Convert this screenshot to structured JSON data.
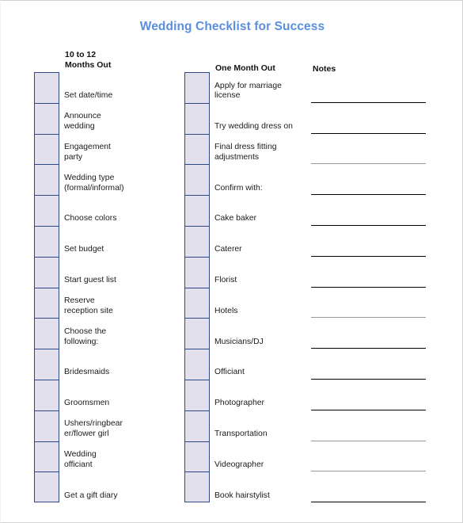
{
  "document": {
    "title": "Wedding Checklist for Success",
    "title_color": "#5a8ede"
  },
  "headers": {
    "left_column": "10 to 12\nMonths Out",
    "right_column": "One Month Out",
    "notes_column": "Notes"
  },
  "colors": {
    "checkbox_fill": "#e3e0ee",
    "checkbox_border": "#2e4a86",
    "rule_black": "#000000",
    "rule_gray": "#9a9a9a",
    "page_border": "#d2d2d2"
  },
  "columns": {
    "left": {
      "heading": "10 to 12 Months Out",
      "items": [
        {
          "label": "Set date/time",
          "checked": false
        },
        {
          "label": "Announce\nwedding",
          "checked": false
        },
        {
          "label": "Engagement\nparty",
          "checked": false
        },
        {
          "label": "Wedding type\n(formal/informal)",
          "checked": false
        },
        {
          "label": "Choose colors",
          "checked": false
        },
        {
          "label": "Set budget",
          "checked": false
        },
        {
          "label": "Start guest list",
          "checked": false
        },
        {
          "label": "Reserve\nreception site",
          "checked": false
        },
        {
          "label": "Choose the\nfollowing:",
          "checked": false
        },
        {
          "label": "Bridesmaids",
          "checked": false
        },
        {
          "label": "Groomsmen",
          "checked": false
        },
        {
          "label": "Ushers/ringbear\ner/flower girl",
          "checked": false
        },
        {
          "label": "Wedding\nofficiant",
          "checked": false
        },
        {
          "label": "Get a gift diary",
          "checked": false
        }
      ]
    },
    "right": {
      "heading": "One Month Out",
      "items": [
        {
          "label": "Apply for marriage\nlicense",
          "checked": false,
          "note_rule": "black"
        },
        {
          "label": "Try wedding dress on",
          "checked": false,
          "note_rule": "black"
        },
        {
          "label": "Final dress fitting\nadjustments",
          "checked": false,
          "note_rule": "gray"
        },
        {
          "label": "Confirm with:",
          "checked": false,
          "note_rule": "black"
        },
        {
          "label": "Cake baker",
          "checked": false,
          "note_rule": "black"
        },
        {
          "label": "Caterer",
          "checked": false,
          "note_rule": "black"
        },
        {
          "label": "Florist",
          "checked": false,
          "note_rule": "black"
        },
        {
          "label": "Hotels",
          "checked": false,
          "note_rule": "gray"
        },
        {
          "label": "Musicians/DJ",
          "checked": false,
          "note_rule": "black"
        },
        {
          "label": "Officiant",
          "checked": false,
          "note_rule": "black"
        },
        {
          "label": "Photographer",
          "checked": false,
          "note_rule": "black"
        },
        {
          "label": "Transportation",
          "checked": false,
          "note_rule": "gray"
        },
        {
          "label": "Videographer",
          "checked": false,
          "note_rule": "gray"
        },
        {
          "label": "Book hairstylist",
          "checked": false,
          "note_rule": "black"
        }
      ]
    }
  }
}
